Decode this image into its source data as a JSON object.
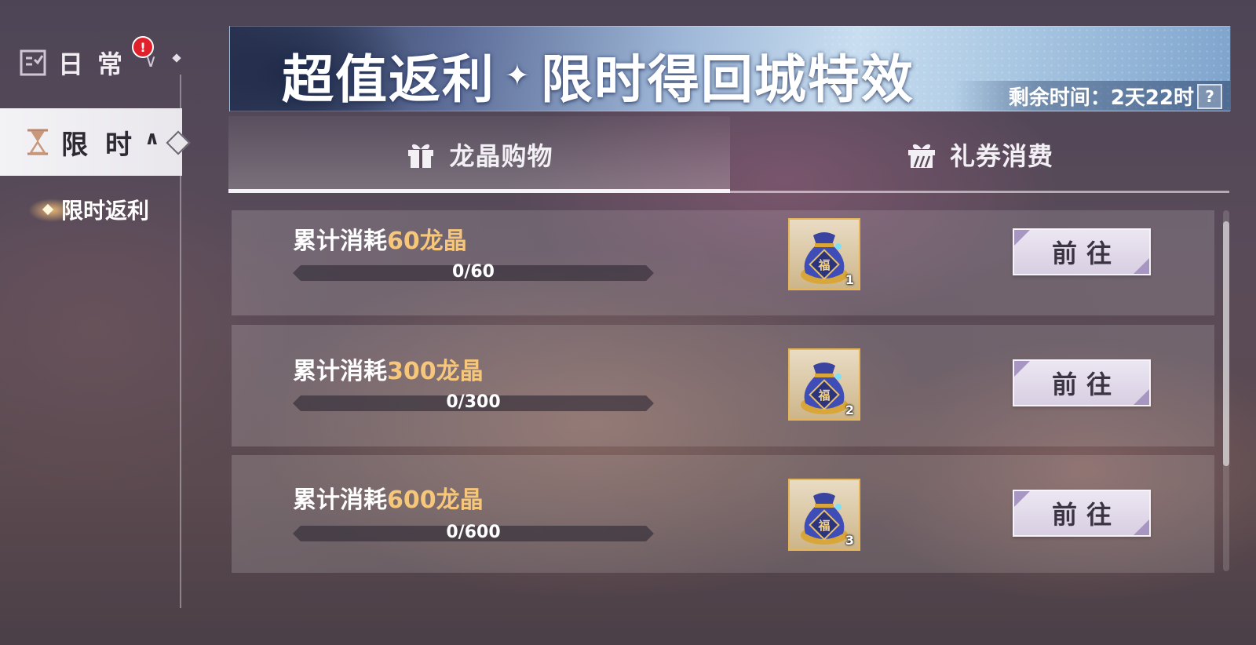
{
  "sidebar": {
    "daily_label": "日常",
    "daily_badge": "!",
    "limited_label": "限时",
    "sub_item_label": "限时返利"
  },
  "banner": {
    "title_left": "超值返利",
    "title_right": "限时得回城特效",
    "timer": "剩余时间：2天22时",
    "help": "?"
  },
  "tabs": [
    {
      "label": "龙晶购物",
      "icon": "gift-icon",
      "active": true
    },
    {
      "label": "礼券消费",
      "icon": "gift-ticket-icon",
      "active": false
    }
  ],
  "rows": [
    {
      "title_prefix": "累计消耗",
      "title_highlight": "60龙晶",
      "progress_text": "0/60",
      "progress": 0,
      "reward_icon": "lucky-bag-icon",
      "reward_qty": "1",
      "button": "前往"
    },
    {
      "title_prefix": "累计消耗",
      "title_highlight": "300龙晶",
      "progress_text": "0/300",
      "progress": 0,
      "reward_icon": "lucky-bag-icon",
      "reward_qty": "2",
      "button": "前往"
    },
    {
      "title_prefix": "累计消耗",
      "title_highlight": "600龙晶",
      "progress_text": "0/600",
      "progress": 0,
      "reward_icon": "lucky-bag-icon",
      "reward_qty": "3",
      "button": "前往"
    }
  ],
  "colors": {
    "highlight": "#f6c67a",
    "reward_border": "#e9b656",
    "alert": "#e0202b",
    "button_corner": "#a796c2"
  }
}
